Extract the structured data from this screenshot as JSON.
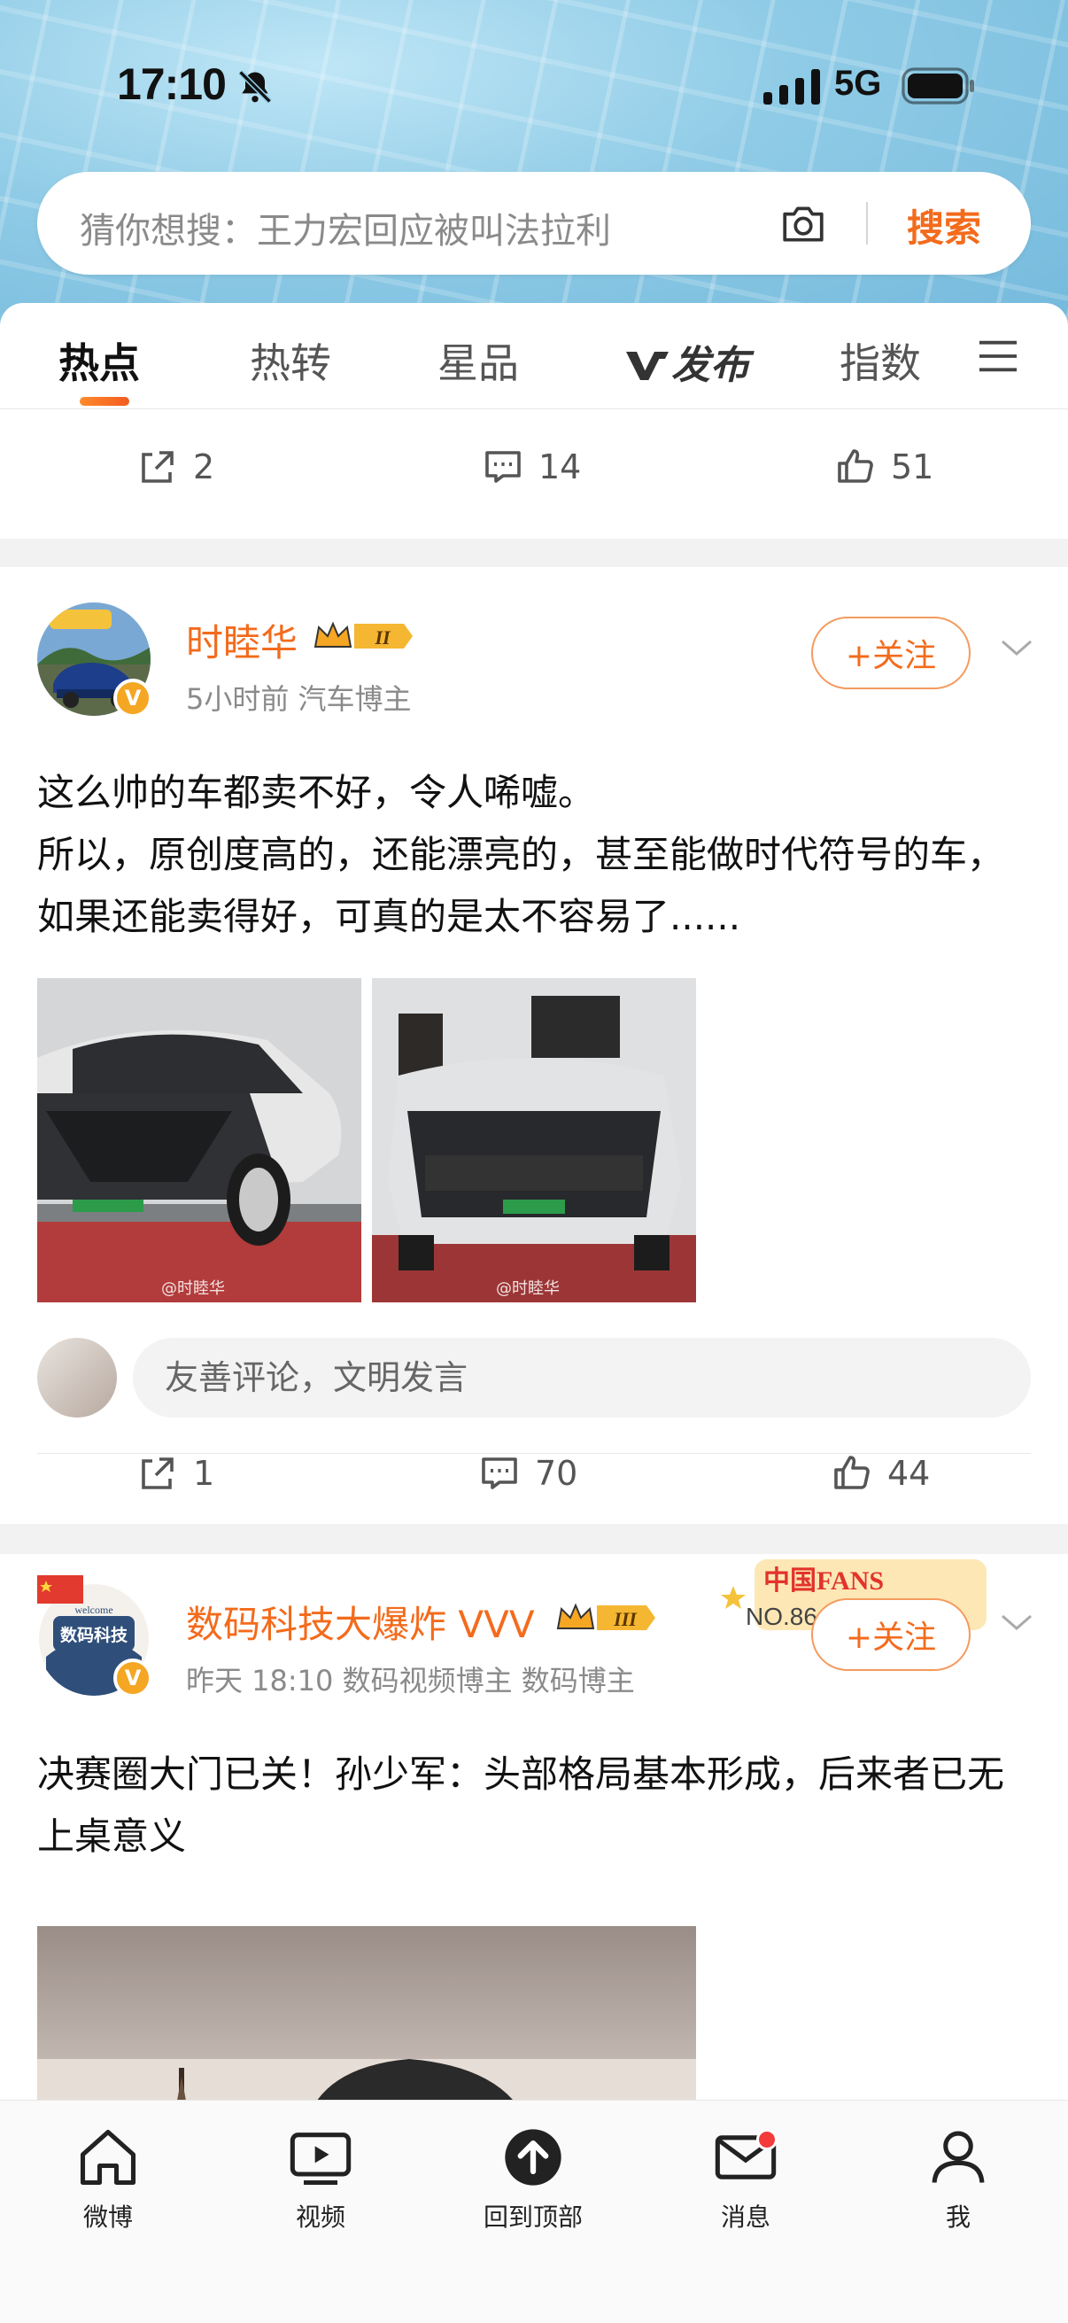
{
  "status": {
    "time": "17:10",
    "network": "5G"
  },
  "search": {
    "hint": "猜你想搜：王力宏回应被叫法拉利",
    "button": "搜索"
  },
  "tabs": [
    {
      "label": "热点",
      "active": true
    },
    {
      "label": "热转"
    },
    {
      "label": "星品"
    },
    {
      "label": "发布"
    },
    {
      "label": "指数"
    }
  ],
  "prev_post": {
    "reposts": "2",
    "comments": "14",
    "likes": "51"
  },
  "post1": {
    "user": "时睦华",
    "level": "II",
    "meta": "5小时前  汽车博主",
    "follow": "+关注",
    "text_line1": "这么帅的车都卖不好，令人唏嘘。",
    "text_line2": "所以，原创度高的，还能漂亮的，甚至能做时代符号的车，如果还能卖得好，可真的是太不容易了......",
    "watermark": "@时睦华",
    "comment_placeholder": "友善评论，文明发言",
    "reposts": "1",
    "comments": "70",
    "likes": "44"
  },
  "post2": {
    "user": "数码科技大爆炸 VVV",
    "level": "III",
    "meta": "昨天 18:10  数码视频博主 数码博主",
    "follow": "+关注",
    "avatar_text": "数码科技",
    "avatar_welcome": "welcome",
    "fans_badge": "中国FANS",
    "fans_no": "NO.86",
    "text": "决赛圈大门已关！孙少军：头部格局基本形成，后来者已无上桌意义"
  },
  "nav": {
    "home": "微博",
    "video": "视频",
    "top": "回到顶部",
    "messages": "消息",
    "me": "我"
  },
  "colors": {
    "accent": "#f36b1c",
    "vip": "#f5a623",
    "badge_red": "#f33b3b"
  }
}
